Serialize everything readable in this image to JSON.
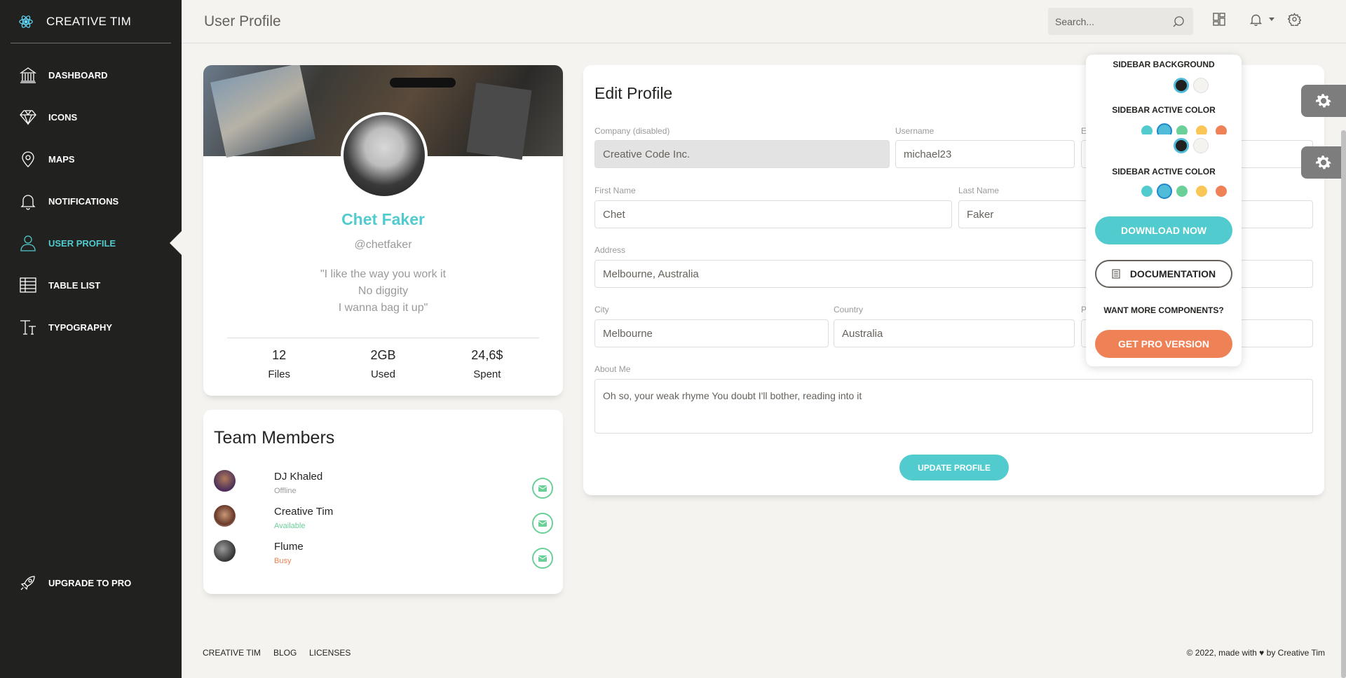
{
  "brand": {
    "name": "CREATIVE TIM"
  },
  "sidebar": {
    "items": [
      {
        "label": "DASHBOARD",
        "icon": "bank-icon"
      },
      {
        "label": "ICONS",
        "icon": "diamond-icon"
      },
      {
        "label": "MAPS",
        "icon": "map-pin-icon"
      },
      {
        "label": "NOTIFICATIONS",
        "icon": "bell-icon"
      },
      {
        "label": "USER PROFILE",
        "icon": "user-icon",
        "active": true
      },
      {
        "label": "TABLE LIST",
        "icon": "list-icon"
      },
      {
        "label": "TYPOGRAPHY",
        "icon": "text-icon"
      }
    ],
    "upgrade": "UPGRADE TO PRO"
  },
  "header": {
    "title": "User Profile",
    "search_placeholder": "Search..."
  },
  "profile": {
    "name": "Chet Faker",
    "username": "@chetfaker",
    "quote_lines": [
      "\"I like the way you work it",
      "No diggity",
      "I wanna bag it up\""
    ],
    "stats": [
      {
        "value": "12",
        "label": "Files"
      },
      {
        "value": "2GB",
        "label": "Used"
      },
      {
        "value": "24,6$",
        "label": "Spent"
      }
    ]
  },
  "team": {
    "title": "Team Members",
    "members": [
      {
        "name": "DJ Khaled",
        "status": "Offline",
        "status_color": "#9a9a9a"
      },
      {
        "name": "Creative Tim",
        "status": "Available",
        "status_color": "#6bd098"
      },
      {
        "name": "Flume",
        "status": "Busy",
        "status_color": "#ef8157"
      }
    ]
  },
  "edit": {
    "title": "Edit Profile",
    "company_label": "Company (disabled)",
    "company_value": "Creative Code Inc.",
    "username_label": "Username",
    "username_value": "michael23",
    "email_label": "E",
    "firstname_label": "First Name",
    "firstname_value": "Chet",
    "lastname_label": "Last Name",
    "lastname_value": "Faker",
    "address_label": "Address",
    "address_value": "Melbourne, Australia",
    "city_label": "City",
    "city_value": "Melbourne",
    "country_label": "Country",
    "country_value": "Australia",
    "postal_label": "P",
    "about_label": "About Me",
    "about_value": "Oh so, your weak rhyme You doubt I'll bother, reading into it",
    "update_button": "UPDATE PROFILE"
  },
  "plugin": {
    "bg_header": "SIDEBAR BACKGROUND",
    "active_header": "SIDEBAR ACTIVE COLOR",
    "active_header2": "SIDEBAR ACTIVE COLOR",
    "download": "DOWNLOAD NOW",
    "documentation": "DOCUMENTATION",
    "more": "WANT MORE COMPONENTS?",
    "pro": "GET PRO VERSION",
    "colors": {
      "primary": "#51cbce",
      "info": "#51bcda",
      "success": "#6bd098",
      "warning": "#fbc658",
      "danger": "#ef8157",
      "black": "#212120"
    }
  },
  "footer": {
    "links": [
      "CREATIVE TIM",
      "BLOG",
      "LICENSES"
    ],
    "copyright_prefix": "© 2022, made with",
    "copyright_suffix": "by Creative Tim"
  }
}
